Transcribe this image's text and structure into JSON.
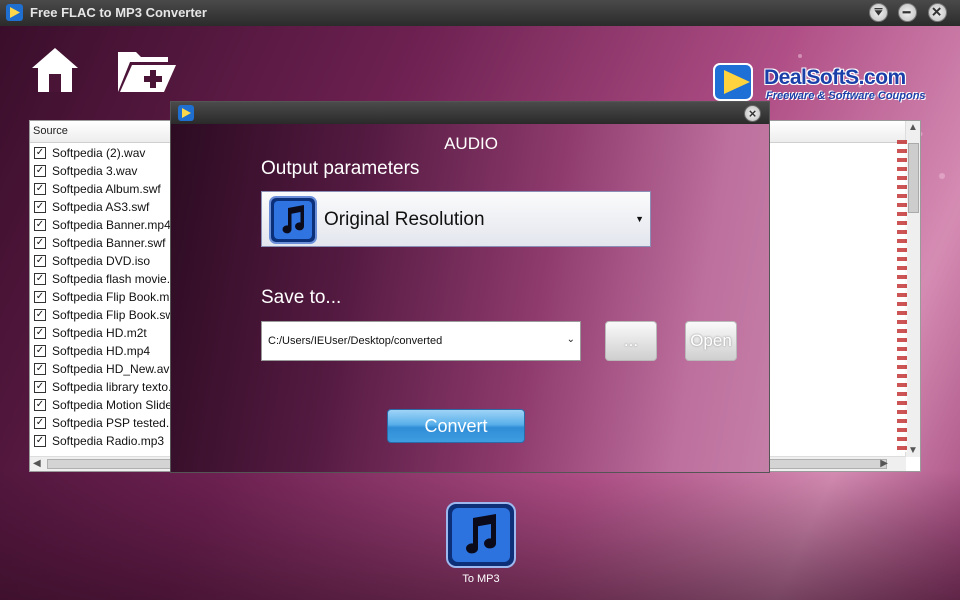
{
  "window": {
    "title": "Free FLAC to MP3 Converter",
    "controls": [
      "help-icon",
      "minimize-icon",
      "close-icon"
    ]
  },
  "toolbar": {
    "icons": [
      "home-icon",
      "add-folder-icon"
    ]
  },
  "brand": {
    "name": "DealSoftS.com",
    "tagline": "Freeware & Software Coupons"
  },
  "file_list": {
    "column_header": "Source",
    "files": [
      {
        "name": "Softpedia (2).wav",
        "checked": true
      },
      {
        "name": "Softpedia 3.wav",
        "checked": true
      },
      {
        "name": "Softpedia Album.swf",
        "checked": true
      },
      {
        "name": "Softpedia AS3.swf",
        "checked": true
      },
      {
        "name": "Softpedia Banner.mp4",
        "checked": true
      },
      {
        "name": "Softpedia Banner.swf",
        "checked": true
      },
      {
        "name": "Softpedia DVD.iso",
        "checked": true
      },
      {
        "name": "Softpedia flash movie.f",
        "checked": true
      },
      {
        "name": "Softpedia Flip Book.m",
        "checked": true
      },
      {
        "name": "Softpedia Flip Book.sw",
        "checked": true
      },
      {
        "name": "Softpedia HD.m2t",
        "checked": true
      },
      {
        "name": "Softpedia HD.mp4",
        "checked": true
      },
      {
        "name": "Softpedia HD_New.avi",
        "checked": true
      },
      {
        "name": "Softpedia library texto.",
        "checked": true
      },
      {
        "name": "Softpedia Motion Slide",
        "checked": true
      },
      {
        "name": "Softpedia PSP tested.m",
        "checked": true
      },
      {
        "name": "Softpedia Radio.mp3",
        "checked": true
      }
    ]
  },
  "dialog": {
    "heading": "AUDIO",
    "output_label": "Output parameters",
    "output_value": "Original Resolution",
    "save_label": "Save to...",
    "save_path": "C:/Users/IEUser/Desktop/converted",
    "browse_label": "...",
    "open_label": "Open",
    "convert_label": "Convert"
  },
  "bottom": {
    "to_mp3_label": "To MP3"
  },
  "colors": {
    "accent_blue": "#2f8dd6",
    "brand_blue": "#1b3fa8",
    "background_purple": "#6e2152"
  }
}
